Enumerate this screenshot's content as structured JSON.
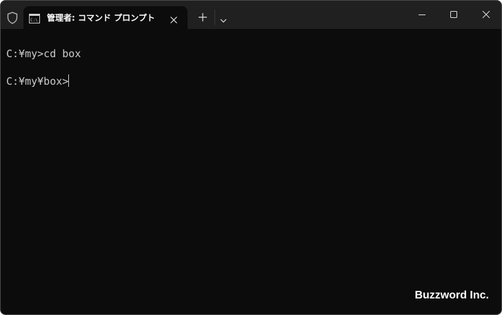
{
  "tab": {
    "title": "管理者: コマンド プロンプト"
  },
  "console": {
    "lines": [
      "C:¥my>cd box",
      "C:¥my¥box>"
    ]
  },
  "watermark": "Buzzword Inc.",
  "icons": {
    "shield": "shield-icon",
    "tab": "cmd-icon",
    "close_tab": "close-icon",
    "new_tab": "plus-icon",
    "dropdown": "chevron-down-icon",
    "minimize": "minimize-icon",
    "maximize": "maximize-icon",
    "close_window": "close-icon"
  }
}
